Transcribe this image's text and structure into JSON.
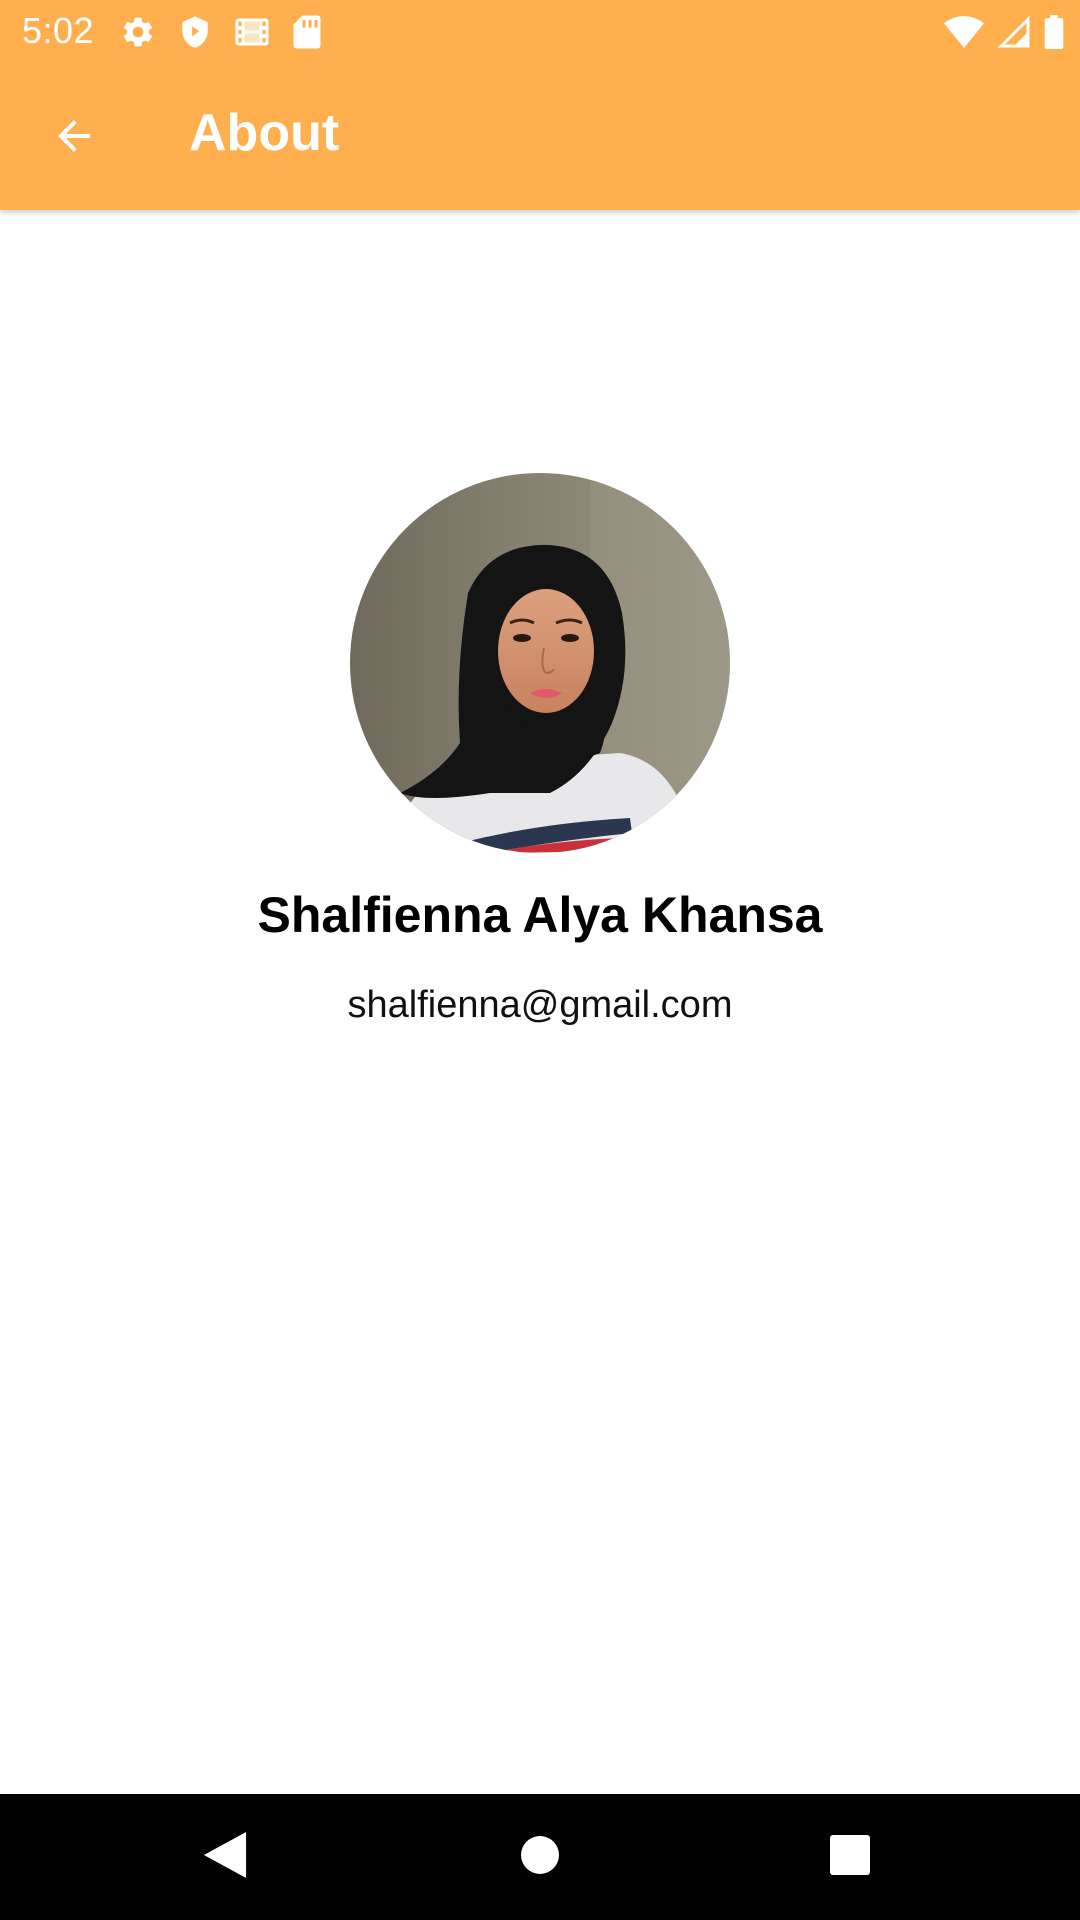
{
  "status_bar": {
    "time": "5:02",
    "background_color": "#FFAF4D",
    "left_icons": [
      "settings-icon",
      "shield-icon",
      "film-icon",
      "sd-card-icon"
    ],
    "right_icons": [
      "wifi-icon",
      "cell-signal-icon",
      "battery-icon"
    ]
  },
  "app_bar": {
    "title": "About",
    "background_color": "#FFAF4D",
    "back_icon": "arrow-back-icon"
  },
  "profile": {
    "name": "Shalfienna Alya Khansa",
    "email": "shalfienna@gmail.com",
    "avatar": "profile-photo"
  },
  "nav_bar": {
    "buttons": [
      "nav-back-icon",
      "nav-home-icon",
      "nav-recents-icon"
    ]
  }
}
